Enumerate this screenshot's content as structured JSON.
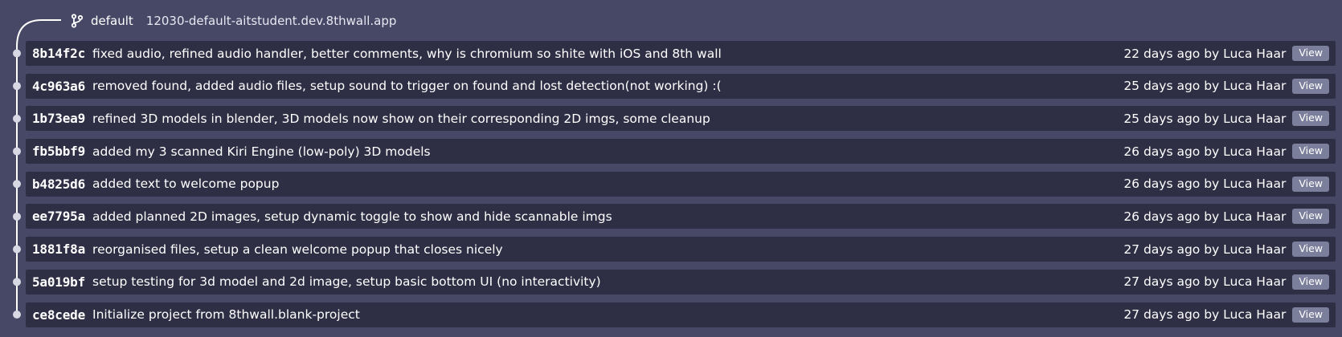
{
  "branch": {
    "name": "default",
    "url": "12030-default-aitstudent.dev.8thwall.app"
  },
  "commits": [
    {
      "hash": "8b14f2c",
      "message": "fixed audio, refined audio handler, better comments, why is chromium so shite with iOS and 8th wall",
      "meta": "22 days ago by Luca Haar",
      "view_label": "View"
    },
    {
      "hash": "4c963a6",
      "message": "removed found, added audio files, setup sound to trigger on found and lost detection(not working) :(",
      "meta": "25 days ago by Luca Haar",
      "view_label": "View"
    },
    {
      "hash": "1b73ea9",
      "message": "refined 3D models in blender, 3D models now show on their corresponding 2D imgs, some cleanup",
      "meta": "25 days ago by Luca Haar",
      "view_label": "View"
    },
    {
      "hash": "fb5bbf9",
      "message": "added my 3 scanned Kiri Engine (low-poly) 3D models",
      "meta": "26 days ago by Luca Haar",
      "view_label": "View"
    },
    {
      "hash": "b4825d6",
      "message": "added text to welcome popup",
      "meta": "26 days ago by Luca Haar",
      "view_label": "View"
    },
    {
      "hash": "ee7795a",
      "message": "added planned 2D images, setup dynamic toggle to show and hide scannable imgs",
      "meta": "26 days ago by Luca Haar",
      "view_label": "View"
    },
    {
      "hash": "1881f8a",
      "message": "reorganised files, setup a clean welcome popup that closes nicely",
      "meta": "27 days ago by Luca Haar",
      "view_label": "View"
    },
    {
      "hash": "5a019bf",
      "message": "setup testing for 3d model and 2d image, setup basic bottom UI (no interactivity)",
      "meta": "27 days ago by Luca Haar",
      "view_label": "View"
    },
    {
      "hash": "ce8cede",
      "message": "Initialize project from 8thwall.blank-project",
      "meta": "27 days ago by Luca Haar",
      "view_label": "View"
    }
  ]
}
